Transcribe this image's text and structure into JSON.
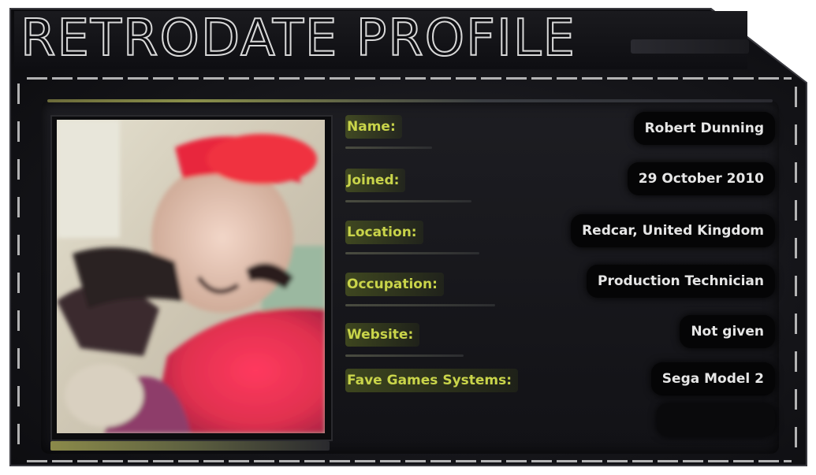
{
  "title": "RETRODATE PROFILE",
  "profile": {
    "name_label": "Name:",
    "name_value": "Robert Dunning",
    "joined_label": "Joined:",
    "joined_value": "29 October 2010",
    "location_label": "Location:",
    "location_value": "Redcar, United Kingdom",
    "occupation_label": "Occupation:",
    "occupation_value": "Production Technician",
    "website_label": "Website:",
    "website_value": "Not given",
    "systems_label": "Fave Games Systems:",
    "systems_value": "Sega Model 2"
  },
  "photo_icon": "profile-photo",
  "colors": {
    "label": "#c9d44a",
    "value_text": "#e6e6e6",
    "card_bg": "#141418",
    "value_bg": "#050506"
  }
}
